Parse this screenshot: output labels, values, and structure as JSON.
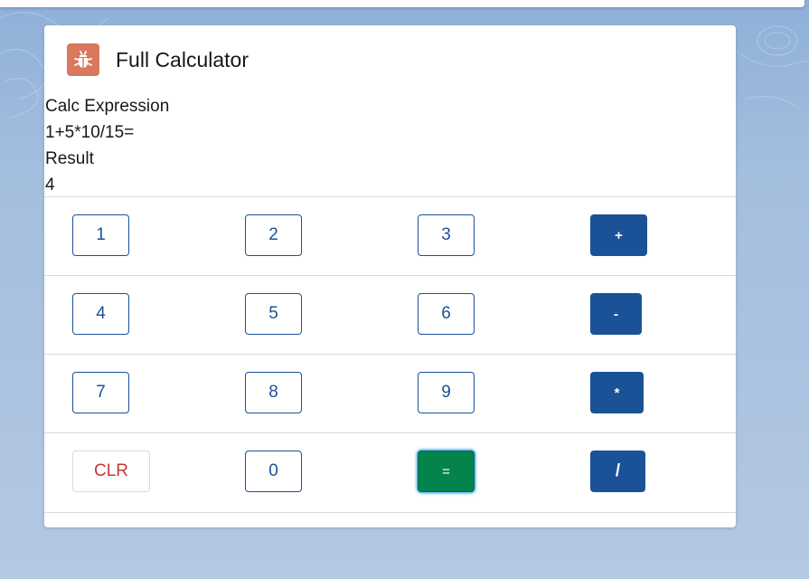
{
  "card": {
    "title": "Full Calculator",
    "icon": "bug-icon",
    "icon_color": "#d9785f"
  },
  "info": {
    "expression_label": "Calc Expression",
    "expression_value": "1+5*10/15=",
    "result_label": "Result",
    "result_value": "4"
  },
  "keypad": {
    "rows": [
      [
        "1",
        "2",
        "3",
        "+"
      ],
      [
        "4",
        "5",
        "6",
        "-"
      ],
      [
        "7",
        "8",
        "9",
        "*"
      ],
      [
        "CLR",
        "0",
        "=",
        "/"
      ]
    ]
  },
  "colors": {
    "brand_blue": "#1b5297",
    "equals_green": "#04844b",
    "clear_red": "#c23934"
  }
}
